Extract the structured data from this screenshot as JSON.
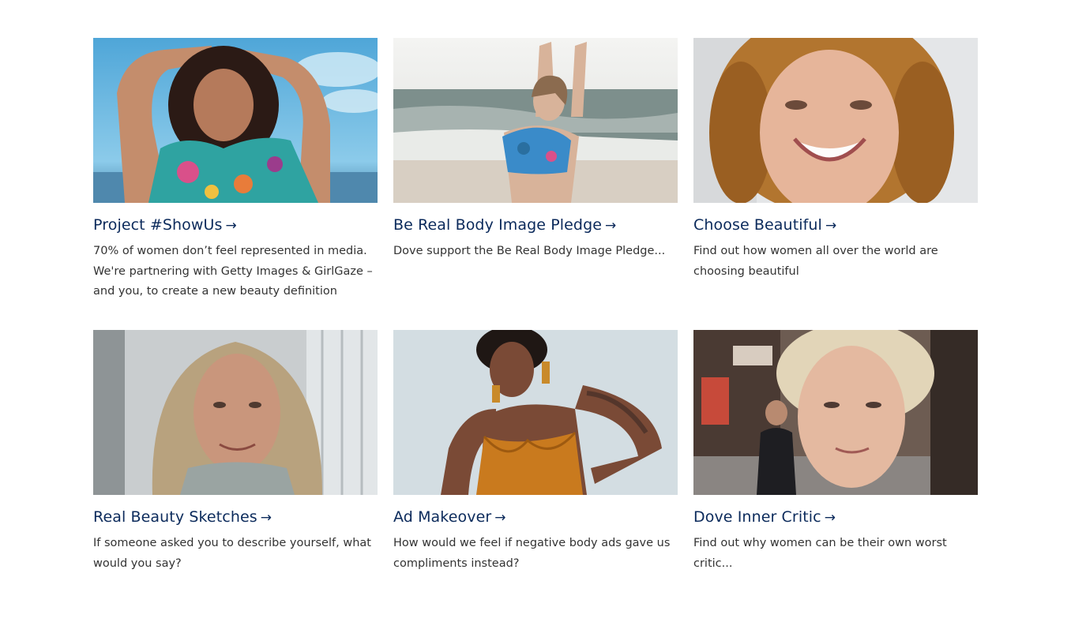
{
  "cards": [
    {
      "title": "Project #ShowUs",
      "arrow": "→",
      "description": "70% of women don’t feel represented in media. We're partnering with Getty Images & GirlGaze – and you, to create a new beauty definition",
      "image": "woman-arms-raised-floral-top"
    },
    {
      "title": "Be Real Body Image Pledge",
      "arrow": "→",
      "description": "Dove support the Be Real Body Image Pledge...",
      "image": "woman-on-beach-bikini"
    },
    {
      "title": "Choose Beautiful",
      "arrow": "→",
      "description": "Find out how women all over the world are choosing beautiful",
      "image": "smiling-curly-haired-woman"
    },
    {
      "title": "Real Beauty Sketches",
      "arrow": "→",
      "description": "If someone asked you to describe yourself, what would you say?",
      "image": "woman-long-blonde-hair-turtleneck"
    },
    {
      "title": "Ad Makeover",
      "arrow": "→",
      "description": "How would we feel if negative body ads gave us compliments instead?",
      "image": "woman-orange-velvet-bodysuit"
    },
    {
      "title": "Dove Inner Critic",
      "arrow": "→",
      "description": "Find out why women can be their own worst critic...",
      "image": "woman-short-blonde-hair-street"
    }
  ],
  "colors": {
    "title": "#0b2a5b",
    "text": "#333333",
    "background": "#ffffff"
  }
}
